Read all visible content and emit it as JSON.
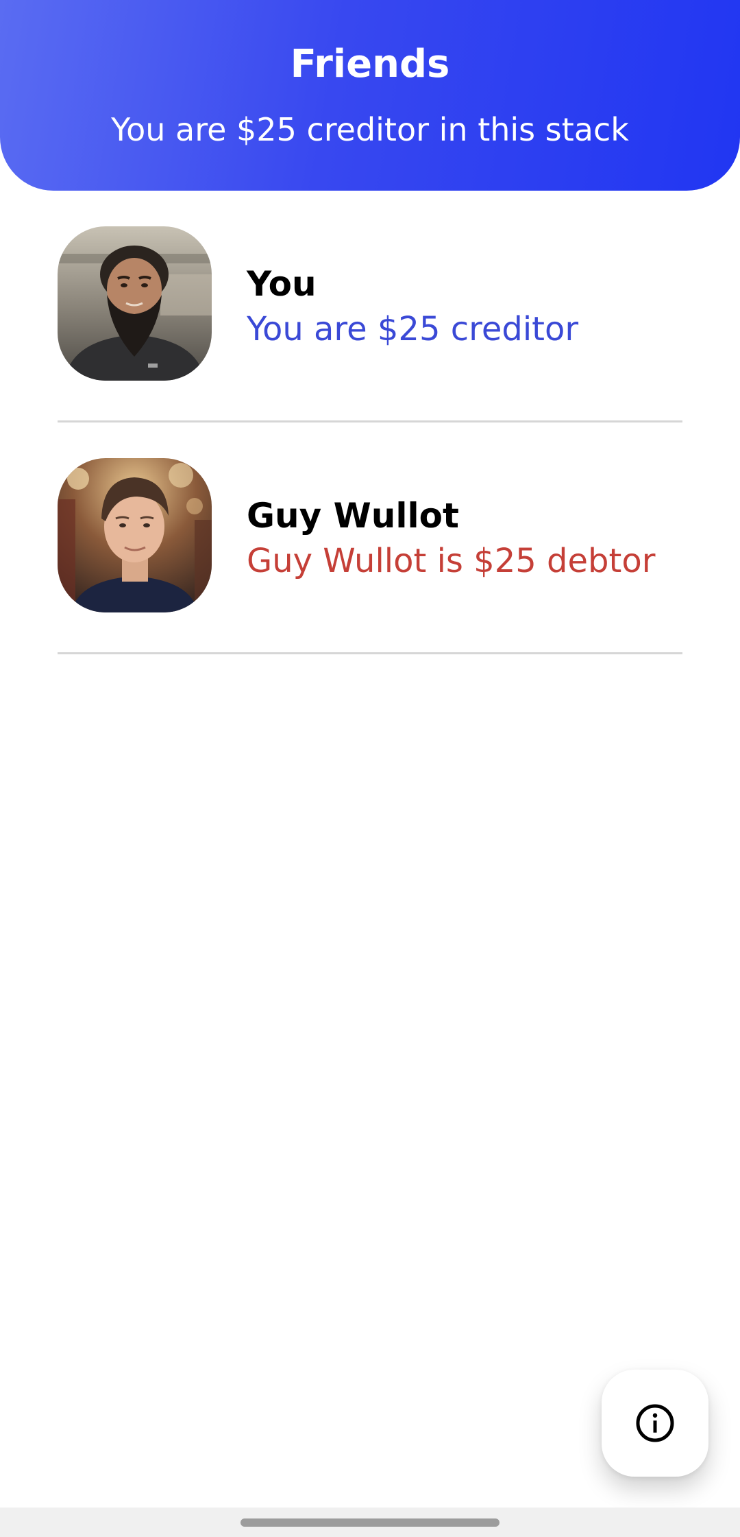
{
  "header": {
    "title": "Friends",
    "subtitle": "You are $25 creditor in this stack"
  },
  "friends": [
    {
      "name": "You",
      "status": "You are $25 creditor",
      "status_type": "creditor",
      "avatar_icon": "user-avatar-photo"
    },
    {
      "name": "Guy Wullot",
      "status": "Guy Wullot is $25 debtor",
      "status_type": "debtor",
      "avatar_icon": "user-avatar-photo"
    }
  ],
  "fab": {
    "icon": "info-icon"
  },
  "colors": {
    "header_gradient_start": "#5a6cf2",
    "header_gradient_end": "#2136f2",
    "creditor": "#3a49d6",
    "debtor": "#c53f37",
    "divider": "#d6d6d6"
  }
}
